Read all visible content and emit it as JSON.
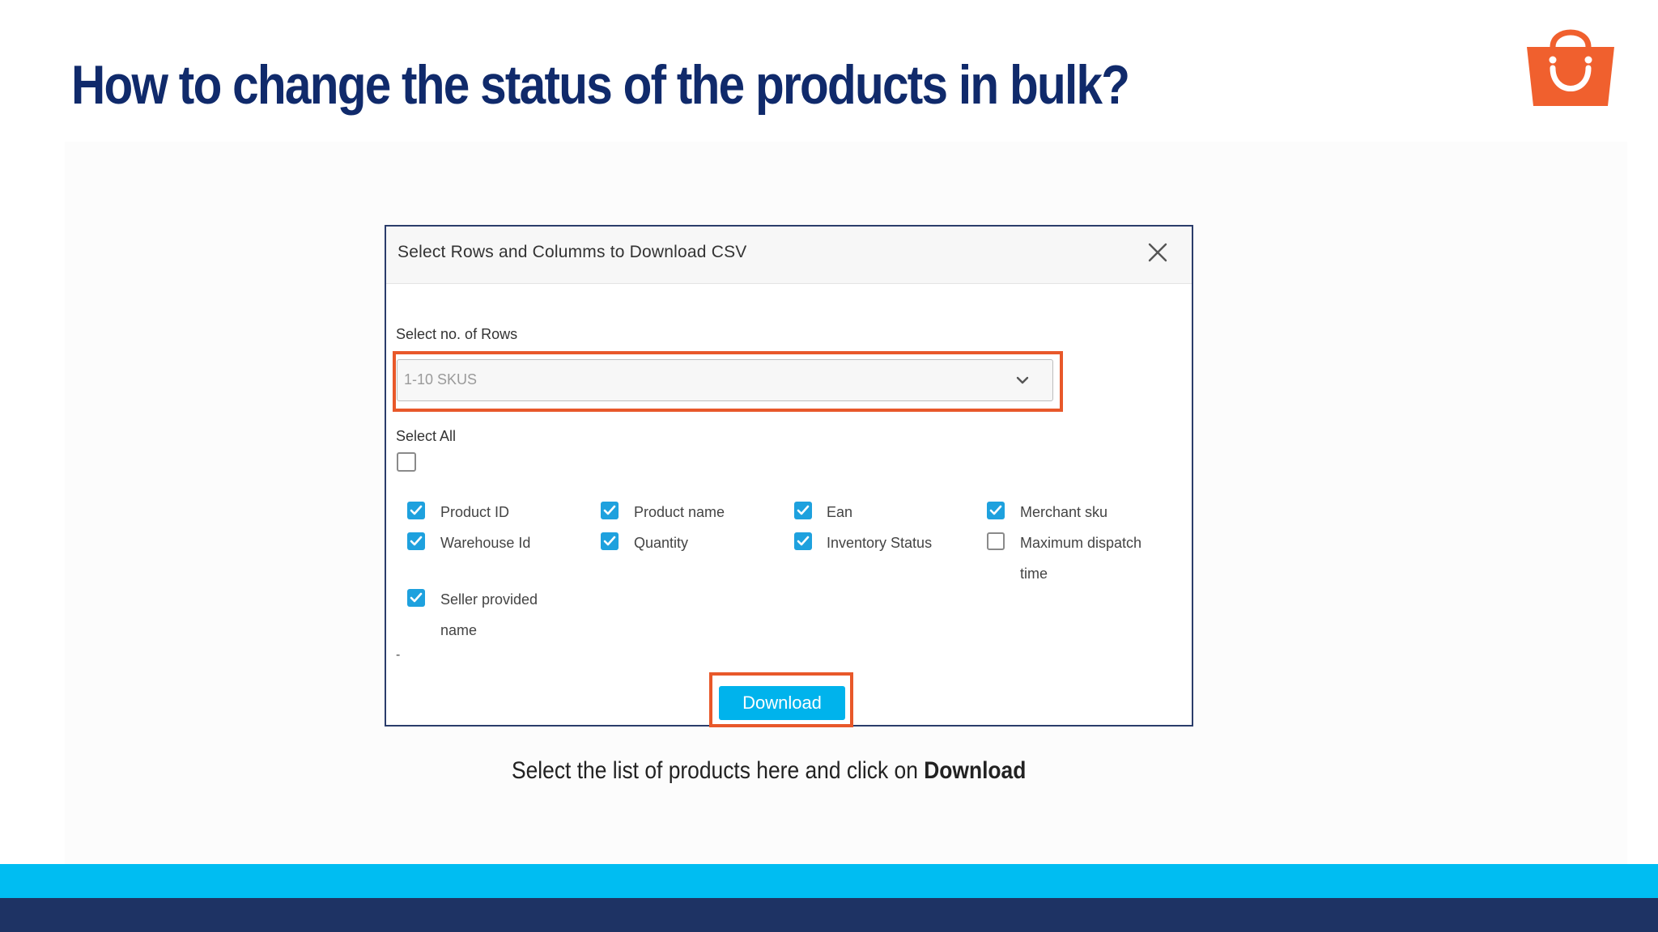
{
  "slide": {
    "title": "How to change the status of the products in bulk?",
    "caption_text": "Select the list of products here and click on ",
    "caption_bold": "Download"
  },
  "dialog": {
    "title": "Select Rows and Columms to Download CSV",
    "rows_label": "Select no. of Rows",
    "rows_value": "1-10 SKUS",
    "select_all_label": "Select All",
    "select_all_checked": false,
    "options": [
      {
        "label": "Product ID",
        "checked": true
      },
      {
        "label": "Product name",
        "checked": true
      },
      {
        "label": "Ean",
        "checked": true
      },
      {
        "label": "Merchant sku",
        "checked": true
      },
      {
        "label": "Warehouse Id",
        "checked": true
      },
      {
        "label": "Quantity",
        "checked": true
      },
      {
        "label": "Inventory Status",
        "checked": true
      },
      {
        "label": "Maximum dispatch time",
        "checked": false
      },
      {
        "label": "Seller provided name",
        "checked": true
      }
    ],
    "dash": "-",
    "download_label": "Download"
  },
  "colors": {
    "title": "#102a6b",
    "highlight": "#e8582a",
    "checkbox": "#1ea1de",
    "button": "#00b3ec",
    "band_light": "#00bdf2",
    "band_dark": "#1e3364",
    "logo": "#f0602e"
  },
  "icons": {
    "logo": "shopping-bag-icon",
    "close": "close-icon",
    "dropdown": "chevron-down-icon",
    "check": "check-icon"
  }
}
